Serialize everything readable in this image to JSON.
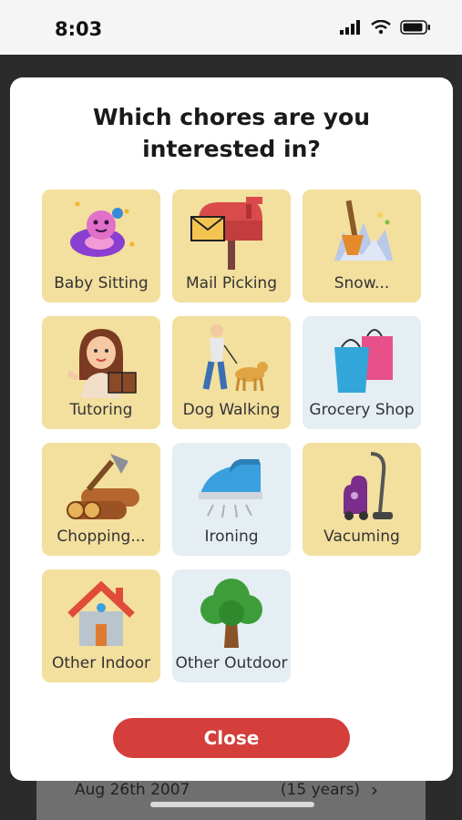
{
  "status_bar": {
    "time": "8:03"
  },
  "background": {
    "date": "Aug 26th 2007",
    "age": "(15 years)",
    "chevron": "›"
  },
  "modal": {
    "title_line1": "Which chores are you",
    "title_line2": "interested in?",
    "close_label": "Close"
  },
  "chores": [
    {
      "label": "Baby Sitting",
      "icon": "pacifier-icon",
      "selected": true
    },
    {
      "label": "Mail Picking",
      "icon": "mailbox-icon",
      "selected": true
    },
    {
      "label": "Snow...",
      "icon": "snow-shovel-icon",
      "selected": true
    },
    {
      "label": "Tutoring",
      "icon": "tutor-icon",
      "selected": true
    },
    {
      "label": "Dog Walking",
      "icon": "dog-walker-icon",
      "selected": true
    },
    {
      "label": "Grocery Shop",
      "icon": "shopping-bags-icon",
      "selected": false
    },
    {
      "label": "Chopping...",
      "icon": "chopping-wood-icon",
      "selected": true
    },
    {
      "label": "Ironing",
      "icon": "iron-icon",
      "selected": false
    },
    {
      "label": "Vacuming",
      "icon": "vacuum-icon",
      "selected": true
    },
    {
      "label": "Other Indoor",
      "icon": "house-icon",
      "selected": true
    },
    {
      "label": "Other Outdoor",
      "icon": "tree-icon",
      "selected": false
    }
  ],
  "colors": {
    "selected_tile": "#f3df9e",
    "unselected_tile": "#e4eef3",
    "close_button": "#d43f3c"
  }
}
